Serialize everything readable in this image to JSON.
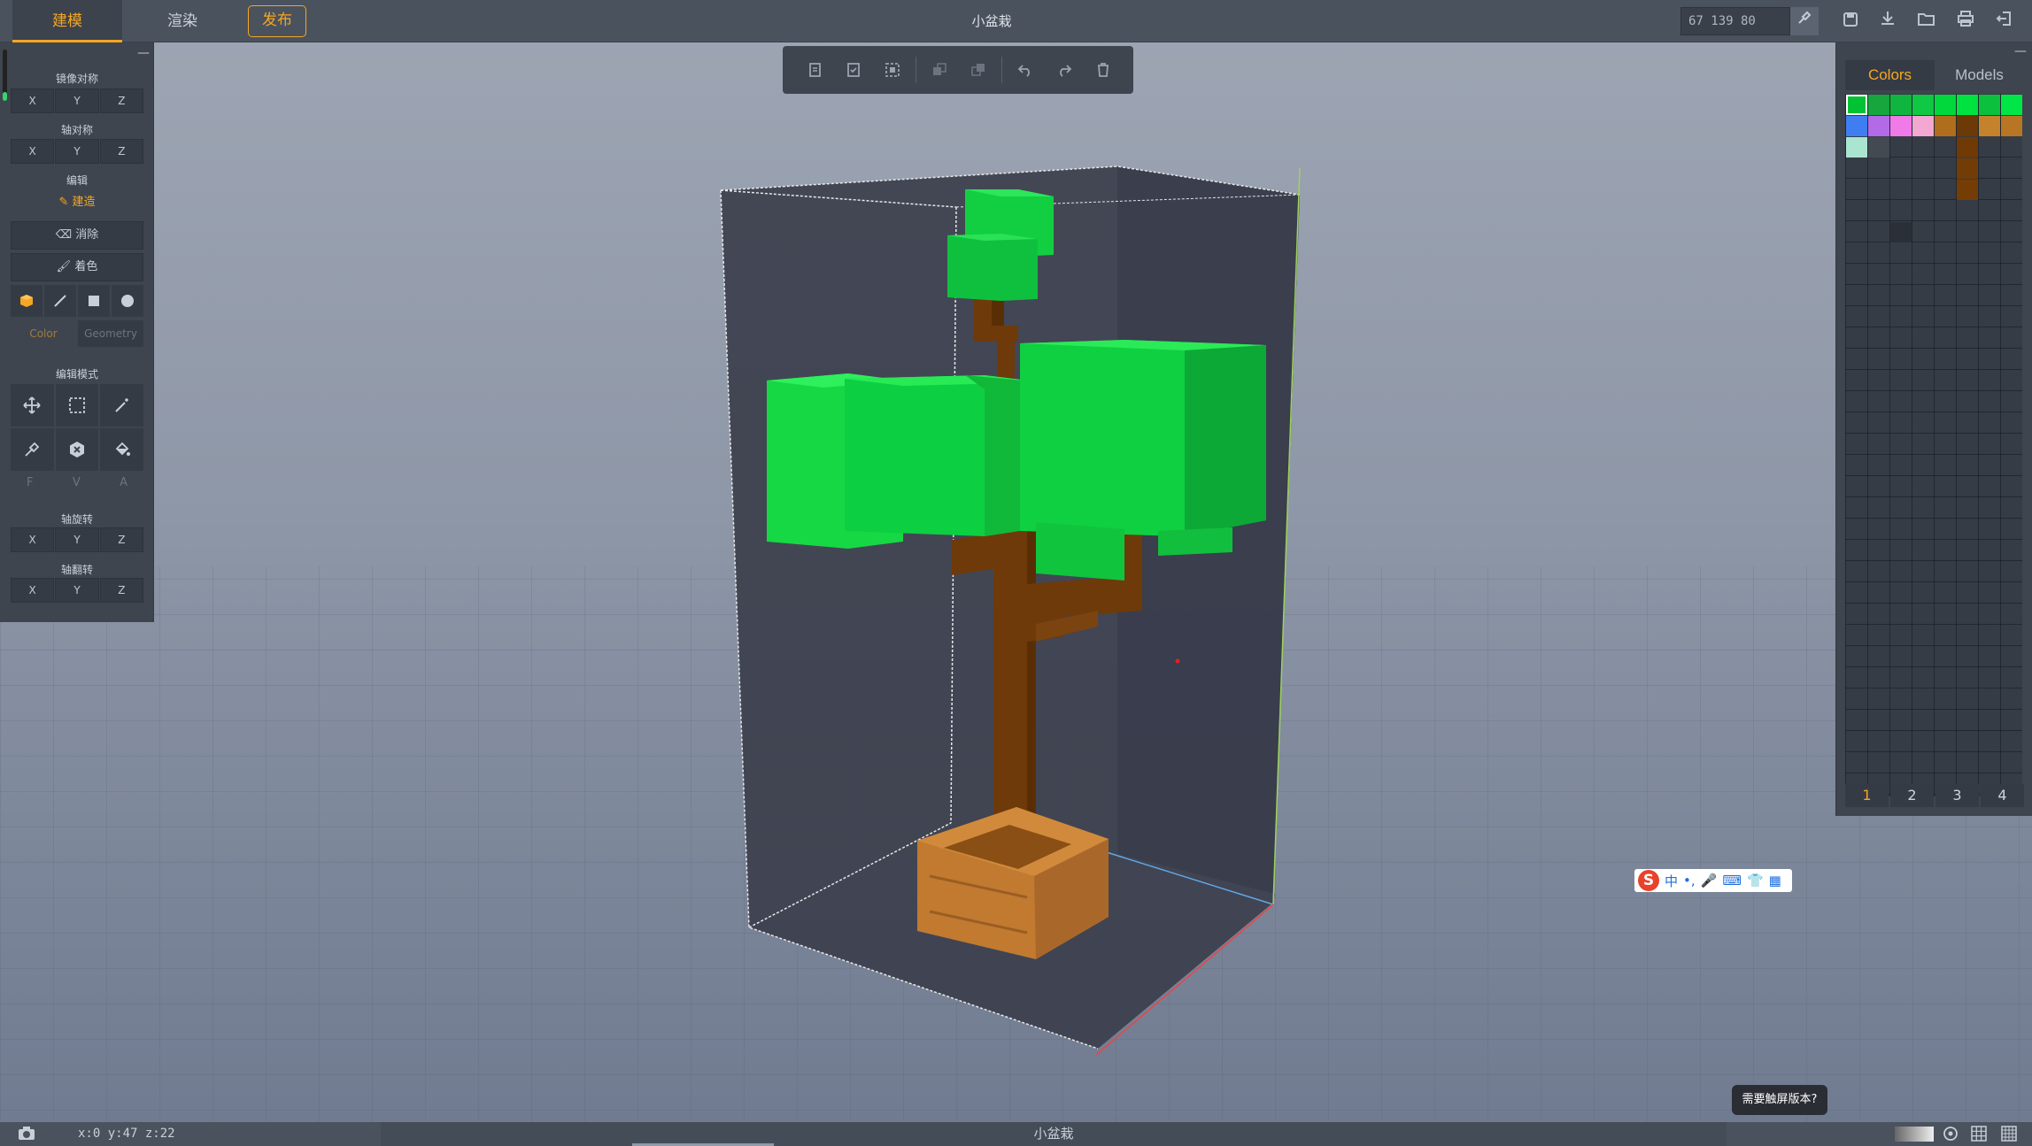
{
  "topbar": {
    "tabs": [
      {
        "label": "建模",
        "active": true
      },
      {
        "label": "渲染",
        "active": false
      }
    ],
    "publish_label": "发布",
    "title": "小盆栽",
    "color_value": "67 139 80",
    "icons": [
      "eyedropper-icon",
      "save-icon",
      "download-icon",
      "open-folder-icon",
      "print-icon",
      "exit-icon"
    ]
  },
  "left_panel": {
    "mirror_label": "镜像对称",
    "axis_sym_label": "轴对称",
    "edit_label": "编辑",
    "axes": [
      "X",
      "Y",
      "Z"
    ],
    "build_label": "建造",
    "erase_label": "消除",
    "paint_label": "着色",
    "color_tab": "Color",
    "geometry_tab": "Geometry",
    "edit_mode_label": "编辑模式",
    "fva": [
      "F",
      "V",
      "A"
    ],
    "rotate_label": "轴旋转",
    "flip_label": "轴翻转"
  },
  "right_panel": {
    "tabs": [
      {
        "label": "Colors",
        "active": true
      },
      {
        "label": "Models",
        "active": false
      }
    ],
    "pages": [
      "1",
      "2",
      "3",
      "4"
    ],
    "active_page": "1",
    "swatches": [
      {
        "row": 0,
        "col": 0,
        "color": "#00c234",
        "selected": true
      },
      {
        "row": 0,
        "col": 1,
        "color": "#16a63d"
      },
      {
        "row": 0,
        "col": 2,
        "color": "#10b540"
      },
      {
        "row": 0,
        "col": 3,
        "color": "#0fc844"
      },
      {
        "row": 0,
        "col": 4,
        "color": "#00d83c"
      },
      {
        "row": 0,
        "col": 5,
        "color": "#00e240"
      },
      {
        "row": 0,
        "col": 6,
        "color": "#0bc03c"
      },
      {
        "row": 0,
        "col": 7,
        "color": "#00e646"
      },
      {
        "row": 1,
        "col": 0,
        "color": "#3f7ef0"
      },
      {
        "row": 1,
        "col": 1,
        "color": "#b36ae6"
      },
      {
        "row": 1,
        "col": 2,
        "color": "#f07ae8"
      },
      {
        "row": 1,
        "col": 3,
        "color": "#f3a8d2"
      },
      {
        "row": 1,
        "col": 4,
        "color": "#b06e1c"
      },
      {
        "row": 1,
        "col": 5,
        "color": "#6b3a06"
      },
      {
        "row": 1,
        "col": 6,
        "color": "#c5822c"
      },
      {
        "row": 1,
        "col": 7,
        "color": "#b87624"
      },
      {
        "row": 2,
        "col": 0,
        "color": "#a9e5d0"
      },
      {
        "row": 2,
        "col": 1,
        "color": "#444a52"
      },
      {
        "row": 2,
        "col": 5,
        "color": "#6f3a05"
      },
      {
        "row": 3,
        "col": 5,
        "color": "#713c06"
      },
      {
        "row": 4,
        "col": 5,
        "color": "#743d06"
      },
      {
        "row": 6,
        "col": 2,
        "color": "#2b3038"
      }
    ]
  },
  "viewport": {
    "ime_label": "中",
    "touch_prompt": "需要触屏版本?"
  },
  "statusbar": {
    "coords": "x:0 y:47 z:22",
    "title": "小盆栽"
  }
}
